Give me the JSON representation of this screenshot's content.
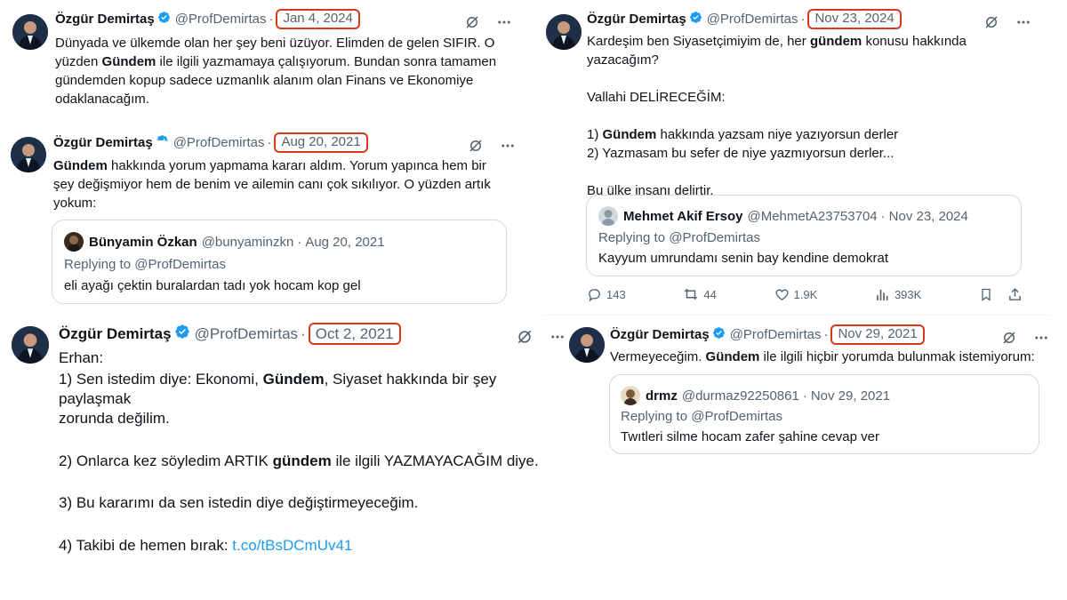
{
  "colors": {
    "highlight": "#d9381e",
    "verified": "#1d9bf0",
    "link": "#1d9bf0",
    "muted": "#536471"
  },
  "icons": [
    "verified-badge-icon",
    "grok-icon",
    "more-icon",
    "reply-icon",
    "retweet-icon",
    "like-icon",
    "views-icon",
    "bookmark-icon",
    "share-icon"
  ],
  "tweets": [
    {
      "name": "Özgür Demirtaş",
      "handle": "@ProfDemirtas",
      "date": "Jan 4, 2024",
      "lines": [
        [
          "Dünyada ve ülkemde olan her şey beni üzüyor. Elimden de gelen SIFIR. O"
        ],
        [
          "yüzden ",
          "Gündem",
          " ile ilgili yazmamaya çalışıyorum. Bundan sonra tamamen"
        ],
        [
          "gündemden kopup sadece uzmanlık alanım olan Finans ve Ekonomiye"
        ],
        [
          "odaklanacağım."
        ]
      ]
    },
    {
      "name": "Özgür Demirtaş",
      "handle": "@ProfDemirtas",
      "date": "Aug 20, 2021",
      "lines": [
        [
          "",
          "Gündem",
          " hakkında yorum yapmama kararı aldım. Yorum yapınca hem bir"
        ],
        [
          "şey değişmiyor hem de benim ve ailemin canı çok sıkılıyor. O yüzden artık"
        ],
        [
          "yokum:"
        ]
      ],
      "quote": {
        "name": "Bünyamin Özkan",
        "handle": "@bunyaminzkn",
        "date": "Aug 20, 2021",
        "reply": "Replying to @ProfDemirtas",
        "text": "eli ayağı çektin buralardan tadı yok hocam kop gel"
      }
    },
    {
      "name": "Özgür Demirtaş",
      "handle": "@ProfDemirtas",
      "date": "Oct 2, 2021",
      "lines": [
        [
          "Erhan:"
        ],
        [
          "1) Sen istedim diye: Ekonomi, ",
          "Gündem",
          ", Siyaset hakkında bir şey paylaşmak"
        ],
        [
          "zorunda değilim."
        ],
        [
          ""
        ],
        [
          "2) Onlarca kez söyledim ARTIK ",
          "gündem",
          " ile ilgili YAZMAYACAĞIM diye."
        ],
        [
          ""
        ],
        [
          "3) Bu kararımı da sen istedin diye değiştirmeyeceğim."
        ],
        [
          ""
        ],
        [
          "4) Takibi de hemen bırak: "
        ]
      ],
      "link": "t.co/tBsDCmUv41"
    },
    {
      "name": "Özgür Demirtaş",
      "handle": "@ProfDemirtas",
      "date": "Nov 23, 2024",
      "lines": [
        [
          "Kardeşim ben Siyasetçimiyim de, her ",
          "gündem",
          " konusu hakkında"
        ],
        [
          "yazacağım?"
        ],
        [
          ""
        ],
        [
          "Vallahi DELİRECEĞİM:"
        ],
        [
          ""
        ],
        [
          "1) ",
          "Gündem",
          " hakkında yazsam niye yazıyorsun derler"
        ],
        [
          "2) Yazmasam bu sefer de niye yazmıyorsun derler..."
        ],
        [
          ""
        ],
        [
          "Bu ülke insanı delirtir."
        ]
      ],
      "quote": {
        "name": "Mehmet Akif Ersoy",
        "handle": "@MehmetA23753704",
        "date": "Nov 23, 2024",
        "reply": "Replying to @ProfDemirtas",
        "text": "Kayyum umrundamı senin bay kendine demokrat"
      },
      "stats": {
        "replies": "143",
        "reposts": "44",
        "likes": "1.9K",
        "views": "393K"
      }
    },
    {
      "name": "Özgür Demirtaş",
      "handle": "@ProfDemirtas",
      "date": "Nov 29, 2021",
      "lines": [
        [
          "Vermeyeceğim. ",
          "Gündem",
          " ile ilgili hiçbir yorumda bulunmak istemiyorum:"
        ]
      ],
      "quote": {
        "name": "drmz",
        "handle": "@durmaz92250861",
        "date": "Nov 29, 2021",
        "reply": "Replying to @ProfDemirtas",
        "text": "Twıtleri silme hocam zafer şahine cevap ver"
      }
    }
  ]
}
